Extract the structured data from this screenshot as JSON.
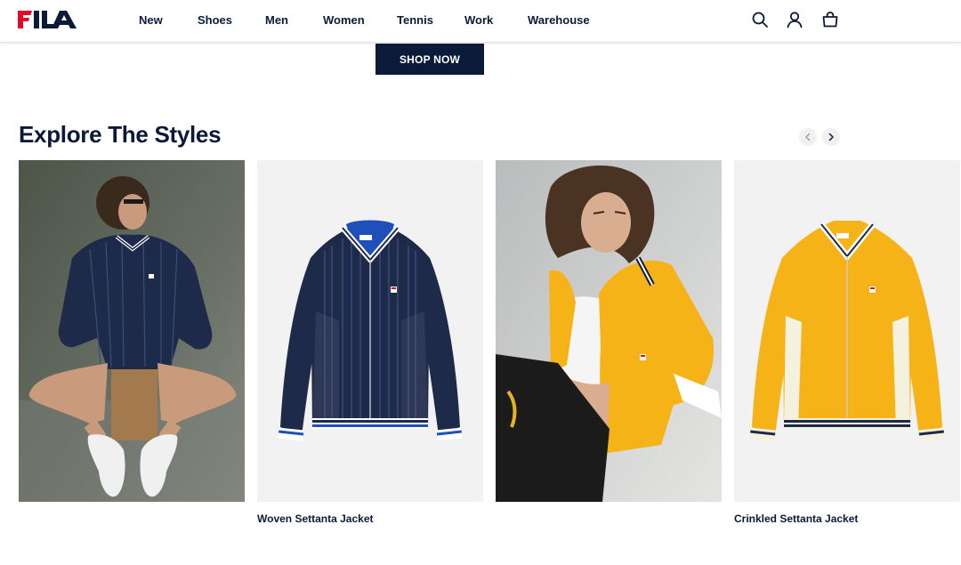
{
  "brand": {
    "name": "FILA",
    "navy": "#0c1a3a",
    "red": "#e10a2a"
  },
  "nav": {
    "items": [
      {
        "label": "New"
      },
      {
        "label": "Shoes"
      },
      {
        "label": "Men"
      },
      {
        "label": "Women"
      },
      {
        "label": "Tennis"
      },
      {
        "label": "Work"
      },
      {
        "label": "Warehouse"
      }
    ]
  },
  "header_icons": [
    "search-icon",
    "account-icon",
    "bag-icon"
  ],
  "hero": {
    "cta_label": "SHOP NOW"
  },
  "section": {
    "title": "Explore The Styles"
  },
  "products": [
    {
      "image": "model-in-navy-striped-jacket",
      "label": ""
    },
    {
      "image": "navy-striped-jacket",
      "label": "Woven Settanta Jacket"
    },
    {
      "image": "model-in-yellow-jacket",
      "label": ""
    },
    {
      "image": "yellow-jacket",
      "label": "Crinkled Settanta Jacket"
    }
  ],
  "colors": {
    "navy_jacket": "#1d2a4a",
    "yellow_jacket": "#f5b318",
    "photo_bg_gray": "#f2f2f2"
  }
}
